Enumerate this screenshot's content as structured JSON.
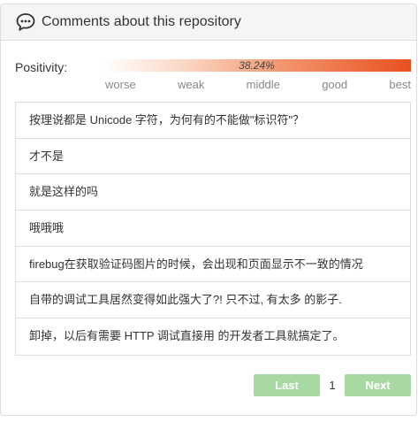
{
  "header": {
    "title": "Comments about this repository",
    "icon": "comments-icon"
  },
  "positivity": {
    "label": "Positivity:",
    "value_text": "38.24%",
    "value": 0.3824,
    "fill_color": "#e8501f",
    "scale": [
      "worse",
      "weak",
      "middle",
      "good",
      "best"
    ]
  },
  "comments": [
    "按理说都是 Unicode 字符，为何有的不能做\"标识符\"？",
    "才不是",
    "就是这样的吗",
    "哦哦哦",
    "firebug在获取验证码图片的时候，会出现和页面显示不一致的情况",
    "自带的调试工具居然变得如此强大了?! 只不过, 有太多 的影子.",
    "卸掉，以后有需要 HTTP 调试直接用 的开发者工具就搞定了。"
  ],
  "pager": {
    "last_label": "Last",
    "page": "1",
    "next_label": "Next",
    "button_color": "#a9d9a3"
  }
}
